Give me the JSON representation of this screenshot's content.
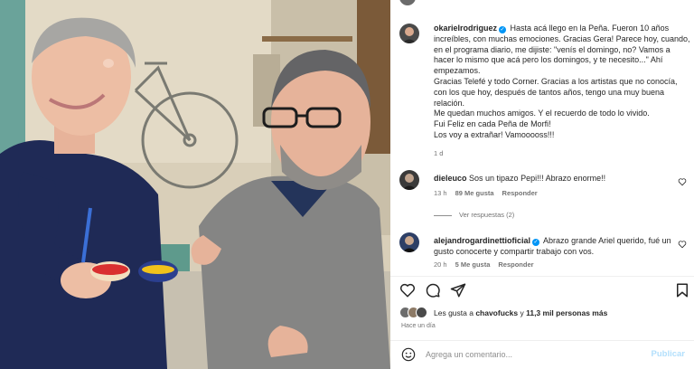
{
  "post": {
    "username": "okarielrodriguez",
    "caption_lines": [
      "Hasta acá llego en la Peña. Fueron 10 años increíbles, con muchas emociones. Gracias Gera! Parece hoy, cuando, en el programa diario, me dijiste: \"venís el domingo, no? Vamos a hacer lo mismo que acá pero los domingos, y te necesito...\" Ahí empezamos.",
      "Gracias Telefé y todo Corner. Gracias a los artistas que no conocía, con los que hoy, después de tantos años, tengo una muy buena relación.",
      "Me quedan muchos amigos. Y el recuerdo de todo lo vivido.",
      "Fui Feliz en cada Peña de Morfi!",
      "Los voy a extrañar! Vamooooss!!!"
    ],
    "time": "1 d"
  },
  "comments": [
    {
      "username": "dieleuco",
      "verified": false,
      "text": "Sos un tipazo Pepi!!! Abrazo enorme!!",
      "time": "13 h",
      "likes": "89 Me gusta",
      "reply": "Responder",
      "view_replies": "Ver respuestas (2)"
    },
    {
      "username": "alejandrogardinettioficial",
      "verified": true,
      "text": "Abrazo grande Ariel querido, fué un gusto conocerte y compartir trabajo con vos.",
      "time": "20 h",
      "likes": "5 Me gusta",
      "reply": "Responder"
    }
  ],
  "likes": {
    "prefix": "Les gusta a ",
    "user": "chavofucks",
    "middle": " y ",
    "count": "11,3 mil personas más"
  },
  "post_date": "Hace un día",
  "comment_box": {
    "placeholder": "Agrega un comentario...",
    "publish": "Publicar"
  },
  "icons": {
    "verified": "verified-badge-icon",
    "heart": "heart-icon",
    "comment": "comment-icon",
    "share": "paper-plane-icon",
    "save": "bookmark-icon",
    "emoji": "smiley-icon"
  },
  "colors": {
    "verified": "#0095f6",
    "publish": "#b2dffc",
    "muted": "#737373",
    "text": "#262626"
  }
}
